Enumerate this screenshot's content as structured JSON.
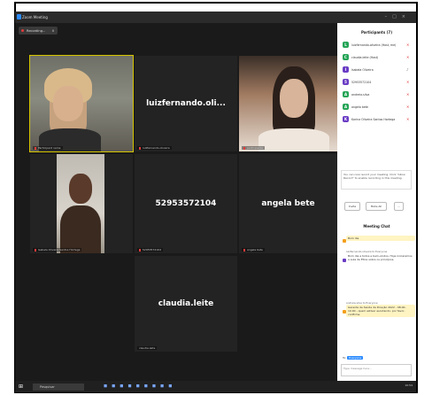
{
  "window": {
    "title": "Zoom Meeting"
  },
  "recording": {
    "label": "Recording..."
  },
  "tiles": [
    {
      "display": "",
      "label": "Participant name"
    },
    {
      "display": "luizfernando.oli...",
      "label": "luizfernando.oliveira"
    },
    {
      "display": "",
      "label": "participante"
    },
    {
      "display": "",
      "label": "Isabela Oliveira Santos Hortega"
    },
    {
      "display": "52953572104",
      "label": "52953572104"
    },
    {
      "display": "angela bete",
      "label": "angela bete"
    },
    {
      "display": "claudia.leite",
      "label": "claudia.leite"
    }
  ],
  "participants_panel": {
    "title": "Participants (7)",
    "items": [
      {
        "initial": "L",
        "name": "luizfernando.oliveira (Host, me)",
        "color": "#23a455"
      },
      {
        "initial": "C",
        "name": "claudia.leite (Host)",
        "color": "#23a455"
      },
      {
        "initial": "I",
        "name": "Isabela Oliveira",
        "color": "#6a3cc4"
      },
      {
        "initial": "5",
        "name": "52953572104",
        "color": "#6a3cc4"
      },
      {
        "initial": "A",
        "name": "andreia.silva",
        "color": "#23a455"
      },
      {
        "initial": "A",
        "name": "angela bete",
        "color": "#23a455"
      },
      {
        "initial": "K",
        "name": "Karina Oliveira Santos Hortega",
        "color": "#6a3cc4"
      }
    ],
    "notice": "You can now record your meeting. Click \"Allow Record\" to enable recording in this meeting.",
    "buttons": {
      "invite": "Invite",
      "mute_all": "Mute All",
      "more": "..."
    }
  },
  "chat": {
    "title": "Meeting Chat",
    "messages": [
      {
        "who": "",
        "text": "Bom dia"
      },
      {
        "who": "luizfernando.oliveira to Everyone",
        "text": "Bom dia a todos e bem-vindos. Hoje iniciaremos a aula de Ética sobre os princípios."
      },
      {
        "who": "andreia.silva to Everyone",
        "text": "Gerente de Saúde da Direção 2022 - 08.00-10.00 - quem estiver escutando, por favor, confirme."
      }
    ],
    "to_label": "To:",
    "to_value": "Everyone",
    "placeholder": "Type message here..."
  },
  "taskbar": {
    "search_placeholder": "Pesquisar",
    "clock": "10:54"
  }
}
